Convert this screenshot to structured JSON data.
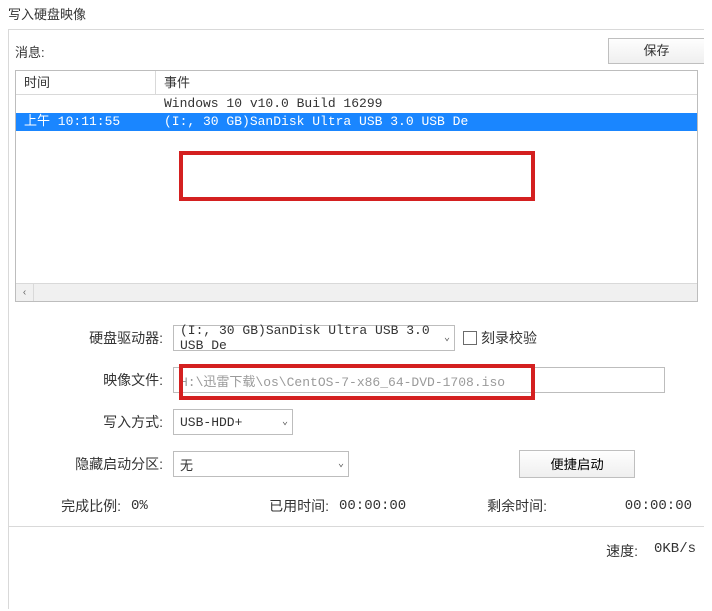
{
  "window_title": "写入硬盘映像",
  "info_label": "消息:",
  "save_button": "保存",
  "grid": {
    "col_time": "时间",
    "col_event": "事件",
    "rows": [
      {
        "time": "",
        "event": "Windows 10 v10.0 Build 16299",
        "selected": false
      },
      {
        "time": "上午 10:11:55",
        "event": "(I:, 30 GB)SanDisk Ultra USB 3.0 USB De",
        "selected": true
      }
    ]
  },
  "labels": {
    "drive": "硬盘驱动器:",
    "image": "映像文件:",
    "method": "写入方式:",
    "hide": "隐藏启动分区:",
    "checksum": "刻录校验",
    "qboot": "便捷启动",
    "pct": "完成比例:",
    "elapsed": "已用时间:",
    "remain": "剩余时间:",
    "speed": "速度:"
  },
  "values": {
    "drive": "(I:, 30 GB)SanDisk Ultra USB 3.0 USB De",
    "image": "H:\\迅雷下载\\os\\CentOS-7-x86_64-DVD-1708.iso",
    "method": "USB-HDD+",
    "hide": "无",
    "pct": "0%",
    "elapsed": "00:00:00",
    "remain": "00:00:00",
    "speed": "0KB/s"
  },
  "scroll_left_glyph": "‹"
}
